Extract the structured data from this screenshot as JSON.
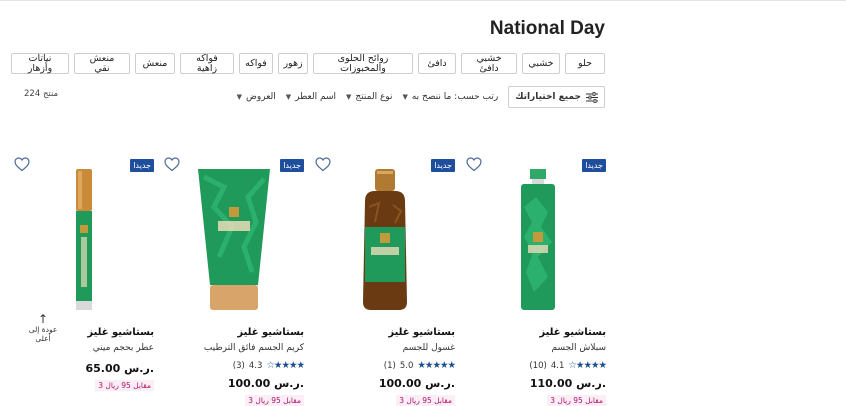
{
  "page_title": "National Day",
  "chips": [
    "حلو",
    "خشبي",
    "خشبي\nدافئ",
    "دافئ",
    "روائح الحلوى\nوالمخبوزات",
    "زهور",
    "فواكه",
    "فواكه\nزاهية",
    "منعش",
    "منعش\nنقي",
    "نباتات\nوأزهار"
  ],
  "sort": {
    "filter_label": "جميع اختياراتك",
    "sort_label": "رتب حسب: ما ننصح به",
    "product_type": "نوع المنتج",
    "scent_name": "اسم العطر",
    "offers": "العروض"
  },
  "product_count": "224 منتج",
  "back_to_top": "عودة إلى أعلى",
  "products": [
    {
      "badge": "جديدا",
      "name": "بستاشيو غليز",
      "type": "سبلاش الجسم",
      "rating": "4.1",
      "reviews": "(10)",
      "stars": "★★★★☆",
      "price": "110.00 ر.س.",
      "promo": "3 مقابل 95 ريال",
      "image": "mist-bottle"
    },
    {
      "badge": "جديدا",
      "name": "بستاشيو غليز",
      "type": "غسول للجسم",
      "rating": "5.0",
      "reviews": "(1)",
      "stars": "★★★★★",
      "price": "100.00 ر.س.",
      "promo": "3 مقابل 95 ريال",
      "image": "gel-bottle"
    },
    {
      "badge": "جديدا",
      "name": "بستاشيو غليز",
      "type": "كريم الجسم فائق الترطيب",
      "rating": "4.3",
      "reviews": "(3)",
      "stars": "★★★★☆",
      "price": "100.00 ر.س.",
      "promo": "3 مقابل 95 ريال",
      "image": "cream-tube"
    },
    {
      "badge": "جديدا",
      "name": "بستاشيو غليز",
      "type": "عطر بحجم ميني",
      "rating": "",
      "reviews": "",
      "stars": "",
      "price": "65.00 ر.س.",
      "promo": "3 مقابل 95 ريال",
      "image": "mini-perfume"
    }
  ],
  "colors": {
    "badge": "#1f4e9c",
    "stars": "#1a4e93",
    "promo": "#b0126e",
    "product_green": "#1f9a5a",
    "gel_amber": "#6a3a12"
  }
}
